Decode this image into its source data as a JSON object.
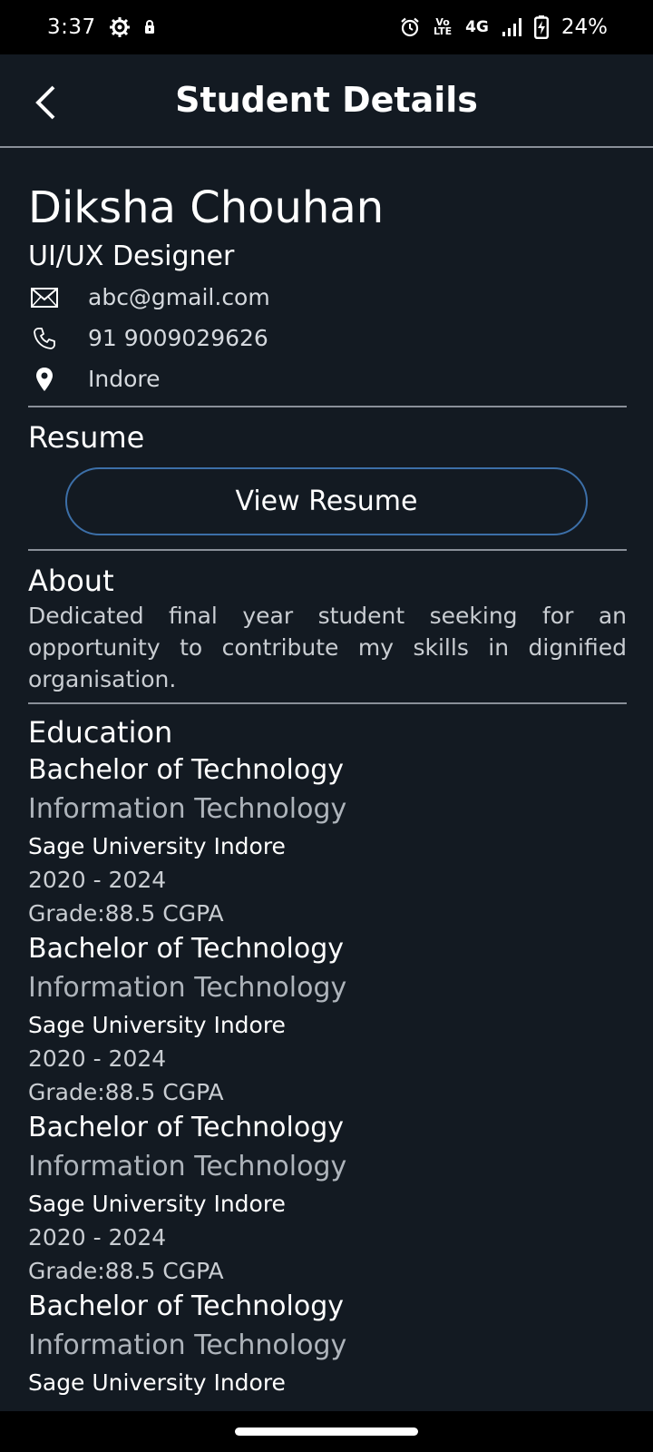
{
  "status_bar": {
    "time": "3:37",
    "battery": "24%",
    "network": "4G",
    "volte": "Vo LTE"
  },
  "header": {
    "title": "Student Details"
  },
  "profile": {
    "name": "Diksha Chouhan",
    "role": "UI/UX Designer",
    "email": "abc@gmail.com",
    "phone": "91 9009029626",
    "location": "Indore"
  },
  "resume": {
    "section_title": "Resume",
    "button_label": "View Resume"
  },
  "about": {
    "section_title": "About",
    "text": "Dedicated final year student seeking for an opportunity to contribute my skills in dignified organisation."
  },
  "education": {
    "section_title": "Education",
    "items": [
      {
        "degree": "Bachelor of Technology",
        "field": "Information Technology",
        "university": "Sage University Indore",
        "years": "2020 - 2024",
        "grade": "Grade:88.5 CGPA"
      },
      {
        "degree": "Bachelor of Technology",
        "field": "Information Technology",
        "university": "Sage University Indore",
        "years": "2020 - 2024",
        "grade": "Grade:88.5 CGPA"
      },
      {
        "degree": "Bachelor of Technology",
        "field": "Information Technology",
        "university": "Sage University Indore",
        "years": "2020 - 2024",
        "grade": "Grade:88.5 CGPA"
      },
      {
        "degree": "Bachelor of Technology",
        "field": "Information Technology",
        "university": "Sage University Indore"
      }
    ]
  },
  "colors": {
    "background": "#131a22",
    "accent_border": "#3c6fa8",
    "divider": "#8a9099"
  },
  "icons": {
    "back": "chevron-left-icon",
    "email": "mail-icon",
    "phone": "phone-icon",
    "location": "location-pin-icon"
  }
}
